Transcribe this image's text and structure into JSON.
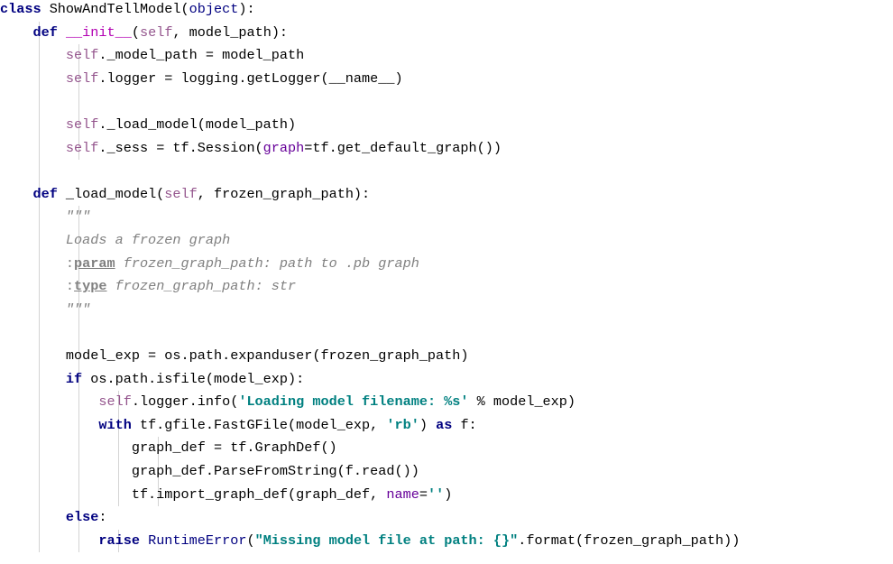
{
  "editor": {
    "language": "python",
    "colors": {
      "keyword": "#000080",
      "self": "#94558d",
      "magic": "#b200b2",
      "string": "#008080",
      "docstring": "#808080",
      "named_param": "#660099",
      "indent_guide": "#d4d4d4"
    },
    "lines": [
      [
        {
          "t": "class",
          "c": "kw"
        },
        {
          "t": " ShowAndTellModel("
        },
        {
          "t": "object",
          "c": "builtin"
        },
        {
          "t": "):"
        }
      ],
      [
        {
          "t": "    "
        },
        {
          "t": "def",
          "c": "kw"
        },
        {
          "t": " "
        },
        {
          "t": "__init__",
          "c": "mag"
        },
        {
          "t": "("
        },
        {
          "t": "self",
          "c": "self"
        },
        {
          "t": ", model_path):"
        }
      ],
      [
        {
          "t": "        "
        },
        {
          "t": "self",
          "c": "self"
        },
        {
          "t": "._model_path = model_path"
        }
      ],
      [
        {
          "t": "        "
        },
        {
          "t": "self",
          "c": "self"
        },
        {
          "t": ".logger = logging.getLogger(__name__)"
        }
      ],
      [],
      [
        {
          "t": "        "
        },
        {
          "t": "self",
          "c": "self"
        },
        {
          "t": "._load_model(model_path)"
        }
      ],
      [
        {
          "t": "        "
        },
        {
          "t": "self",
          "c": "self"
        },
        {
          "t": "._sess = tf.Session("
        },
        {
          "t": "graph",
          "c": "param"
        },
        {
          "t": "=tf.get_default_graph())"
        }
      ],
      [],
      [
        {
          "t": "    "
        },
        {
          "t": "def",
          "c": "kw"
        },
        {
          "t": " _load_model("
        },
        {
          "t": "self",
          "c": "self"
        },
        {
          "t": ", frozen_graph_path):"
        }
      ],
      [
        {
          "t": "        "
        },
        {
          "t": "\"\"\"",
          "c": "doc"
        }
      ],
      [
        {
          "t": "        "
        },
        {
          "t": "Loads a frozen graph",
          "c": "doc"
        }
      ],
      [
        {
          "t": "        "
        },
        {
          "t": ":",
          "c": "dcolon"
        },
        {
          "t": "param",
          "c": "dtag"
        },
        {
          "t": " frozen_graph_path: path to .pb graph",
          "c": "doc"
        }
      ],
      [
        {
          "t": "        "
        },
        {
          "t": ":",
          "c": "dcolon"
        },
        {
          "t": "type",
          "c": "dtag"
        },
        {
          "t": " frozen_graph_path: str",
          "c": "doc"
        }
      ],
      [
        {
          "t": "        "
        },
        {
          "t": "\"\"\"",
          "c": "doc"
        }
      ],
      [],
      [
        {
          "t": "        model_exp = os.path.expanduser(frozen_graph_path)"
        }
      ],
      [
        {
          "t": "        "
        },
        {
          "t": "if",
          "c": "kw"
        },
        {
          "t": " os.path.isfile(model_exp):"
        }
      ],
      [
        {
          "t": "            "
        },
        {
          "t": "self",
          "c": "self"
        },
        {
          "t": ".logger.info("
        },
        {
          "t": "'Loading model filename: %s'",
          "c": "str"
        },
        {
          "t": " % model_exp)"
        }
      ],
      [
        {
          "t": "            "
        },
        {
          "t": "with",
          "c": "kw"
        },
        {
          "t": " tf.gfile.FastGFile(model_exp, "
        },
        {
          "t": "'rb'",
          "c": "str"
        },
        {
          "t": ") "
        },
        {
          "t": "as",
          "c": "kw"
        },
        {
          "t": " f:"
        }
      ],
      [
        {
          "t": "                graph_def = tf.GraphDef()"
        }
      ],
      [
        {
          "t": "                graph_def.ParseFromString(f.read())"
        }
      ],
      [
        {
          "t": "                tf.import_graph_def(graph_def, "
        },
        {
          "t": "name",
          "c": "param"
        },
        {
          "t": "="
        },
        {
          "t": "''",
          "c": "str"
        },
        {
          "t": ")"
        }
      ],
      [
        {
          "t": "        "
        },
        {
          "t": "else",
          "c": "kw"
        },
        {
          "t": ":"
        }
      ],
      [
        {
          "t": "            "
        },
        {
          "t": "raise",
          "c": "kw"
        },
        {
          "t": " "
        },
        {
          "t": "RuntimeError",
          "c": "builtin"
        },
        {
          "t": "("
        },
        {
          "t": "\"Missing model file at path: {}\"",
          "c": "str"
        },
        {
          "t": ".format(frozen_graph_path))"
        }
      ]
    ]
  }
}
